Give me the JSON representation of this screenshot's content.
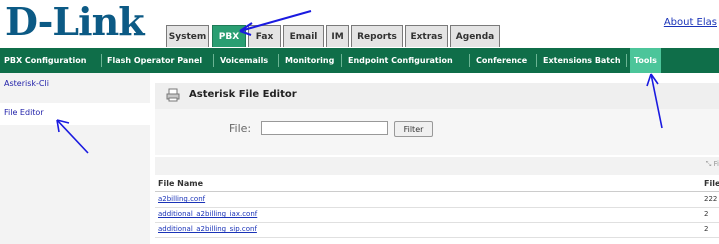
{
  "header": {
    "logo_text": "D-Link",
    "about_link": "About Elas"
  },
  "tabs": [
    {
      "label": "System"
    },
    {
      "label": "PBX"
    },
    {
      "label": "Fax"
    },
    {
      "label": "Email"
    },
    {
      "label": "IM"
    },
    {
      "label": "Reports"
    },
    {
      "label": "Extras"
    },
    {
      "label": "Agenda"
    }
  ],
  "active_tab": "PBX",
  "subnav": [
    {
      "label": "PBX Configuration"
    },
    {
      "label": "Flash Operator Panel"
    },
    {
      "label": "Voicemails"
    },
    {
      "label": "Monitoring"
    },
    {
      "label": "Endpoint Configuration"
    },
    {
      "label": "Conference"
    },
    {
      "label": "Extensions Batch"
    },
    {
      "label": "Tools"
    }
  ],
  "active_subnav": "Tools",
  "sidebar": {
    "items": [
      {
        "label": "Asterisk-Cli"
      },
      {
        "label": "File Editor"
      }
    ],
    "selected": "File Editor"
  },
  "panel": {
    "title": "Asterisk File Editor",
    "filter_label": "File:",
    "filter_value": "",
    "filter_button": "Filter",
    "sort_hint": "Fi"
  },
  "table": {
    "columns": [
      "File Name",
      "File"
    ],
    "rows": [
      {
        "name": "a2billing.conf",
        "size": "222"
      },
      {
        "name": "additional_a2billing_iax.conf",
        "size": "2"
      },
      {
        "name": "additional_a2billing_sip.conf",
        "size": "2"
      }
    ]
  },
  "colors": {
    "brand_blue": "#0c5a85",
    "nav_green": "#0f6e49",
    "active_green": "#2a9e72",
    "annotation_arrow": "#1a1ae0"
  }
}
